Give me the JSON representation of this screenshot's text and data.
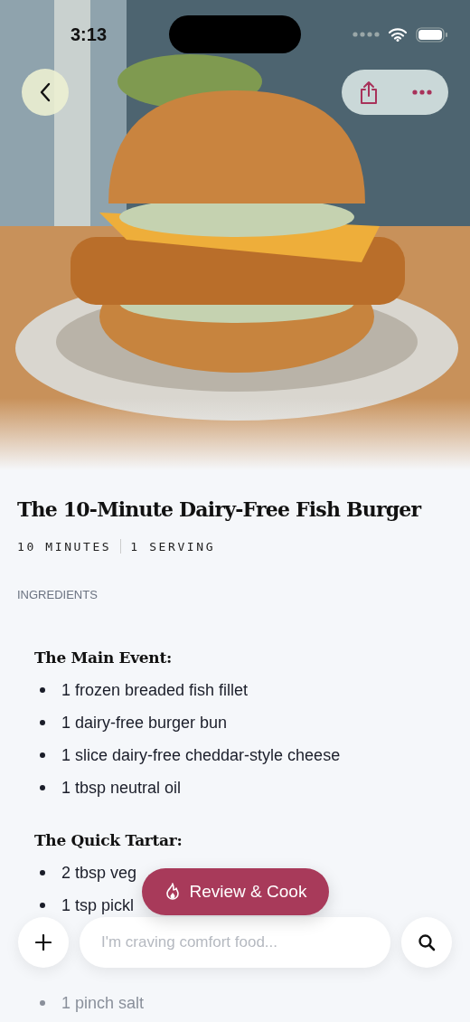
{
  "status_bar": {
    "time": "3:13"
  },
  "recipe": {
    "title": "The 10-Minute Dairy-Free Fish Burger",
    "meta": [
      "10 MINUTES",
      "1 SERVING"
    ]
  },
  "ingredients": {
    "heading": "INGREDIENTS",
    "sections": [
      {
        "title": "The Main Event:",
        "items": [
          {
            "text": "1 frozen breaded fish fillet",
            "faded": false
          },
          {
            "text": "1 dairy-free burger bun",
            "faded": false
          },
          {
            "text": "1 slice dairy-free cheddar-style cheese",
            "faded": false
          },
          {
            "text": "1 tbsp neutral oil",
            "faded": false
          }
        ]
      },
      {
        "title": "The Quick Tartar:",
        "items": [
          {
            "text": "2 tbsp veg",
            "faded": false
          },
          {
            "text": "1 tsp pickl",
            "faded": false
          },
          {
            "text": "1 pinch salt",
            "faded": true
          }
        ]
      }
    ]
  },
  "cook_button": {
    "label": "Review & Cook"
  },
  "chat": {
    "placeholder": "I'm craving comfort food..."
  }
}
